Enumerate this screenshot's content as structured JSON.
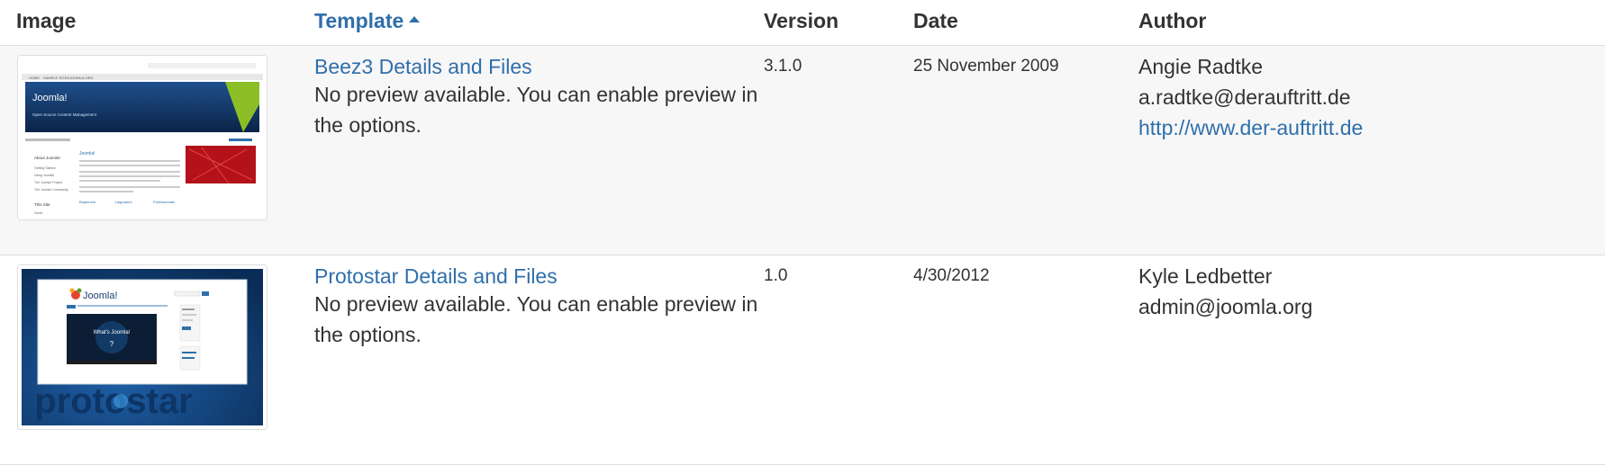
{
  "headers": {
    "image": "Image",
    "template": "Template",
    "version": "Version",
    "date": "Date",
    "author": "Author"
  },
  "rows": [
    {
      "template_link": "Beez3 Details and Files",
      "description": "No preview available. You can enable preview in the options.",
      "version": "3.1.0",
      "date": "25 November 2009",
      "author_name": "Angie Radtke",
      "author_email": "a.radtke@derauftritt.de",
      "author_url": "http://www.der-auftritt.de",
      "thumb": {
        "brand": "Joomla!",
        "tagline": "Open Source Content Management",
        "nav": [
          "HOME",
          "SAMPLE SITES",
          "JOOMLA.ORG"
        ],
        "main_heading": "Joomla!",
        "sidebar_title": "About Joomla!",
        "sidebar_items": [
          "Getting Started",
          "Using Joomla!",
          "The Joomla! Project",
          "The Joomla! Community"
        ],
        "bottom_title": "This Site",
        "bottom_item": "Home",
        "columns": [
          "Beginners",
          "Upgraders",
          "Professionals"
        ],
        "accent": "#1a3e6e"
      }
    },
    {
      "template_link": "Protostar Details and Files",
      "description": "No preview available. You can enable preview in the options.",
      "version": "1.0",
      "date": "4/30/2012",
      "author_name": "Kyle Ledbetter",
      "author_email": "admin@joomla.org",
      "thumb": {
        "brand": "Joomla!",
        "video_caption": "What's Joomla!",
        "wordmark": "protostar",
        "accent": "#0f3c6e"
      }
    }
  ],
  "colors": {
    "link": "#2f6fab",
    "text": "#333333",
    "row_alt": "#f7f7f7",
    "border": "#dddddd"
  }
}
